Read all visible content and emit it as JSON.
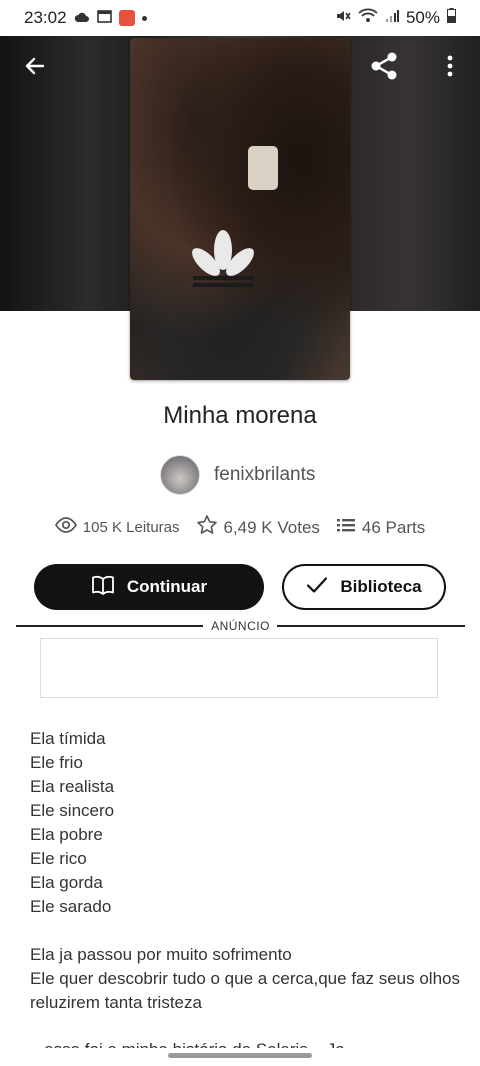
{
  "status_bar": {
    "time": "23:02",
    "battery": "50%",
    "left_icons": [
      "cloud-icon",
      "calendar-icon",
      "app-icon",
      "dot-icon"
    ],
    "right_icons": [
      "mute-icon",
      "wifi-icon",
      "signal-icon",
      "battery-icon"
    ]
  },
  "header": {
    "back_icon": "arrow-left-icon",
    "share_icon": "share-icon",
    "menu_icon": "more-vertical-icon"
  },
  "story": {
    "title": "Minha morena",
    "author": "fenixbrilants",
    "stats": {
      "reads": "105 K Leituras",
      "votes": "6,49 K Votes",
      "parts": "46 Parts"
    }
  },
  "actions": {
    "continue_label": "Continuar",
    "library_label": "Biblioteca"
  },
  "ad": {
    "label": "ANÚNCIO"
  },
  "description": {
    "lines": [
      "Ela tímida",
      "Ele frio",
      "Ela realista",
      "Ele sincero",
      "Ela pobre",
      "Ele rico",
      "Ela gorda",
      "Ele sarado"
    ],
    "para2_line1": "Ela ja passou por muito sofrimento",
    "para2_line2": "Ele quer descobrir tudo o que a cerca,que faz seus olhos",
    "para2_line3": "reluzirem tanta tristeza",
    "cut_off": "...essa foi a minha história de Solaris ...Ja..."
  },
  "colors": {
    "button_dark": "#121212",
    "text_main": "#222222",
    "text_muted": "#555555"
  }
}
